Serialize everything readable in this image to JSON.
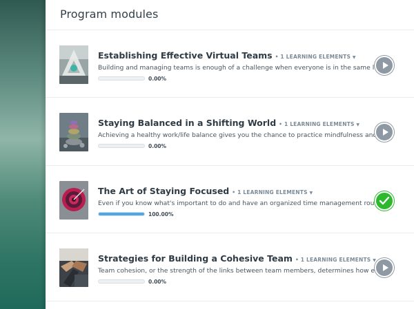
{
  "header": {
    "title": "Program modules"
  },
  "modules": [
    {
      "title": "Establishing Effective Virtual Teams",
      "elements_label": "• 1 LEARNING ELEMENTS",
      "description": "Building and managing teams is enough of a challenge when everyone is in the same location. Provi",
      "progress_label": "0.00%",
      "progress": 0,
      "status_icon": "play-icon"
    },
    {
      "title": "Staying Balanced in a Shifting World",
      "elements_label": "• 1 LEARNING ELEMENTS",
      "description": "Achieving a healthy work/life balance gives you the chance to practice mindfulness and focus on wh",
      "progress_label": "0.00%",
      "progress": 0,
      "status_icon": "play-icon"
    },
    {
      "title": "The Art of Staying Focused",
      "elements_label": "• 1 LEARNING ELEMENTS",
      "description": "Even if you know what's important to do and have an organized time management routine, losing fo",
      "progress_label": "100.00%",
      "progress": 1,
      "status_icon": "check-icon"
    },
    {
      "title": "Strategies for Building a Cohesive Team",
      "elements_label": "• 1 LEARNING ELEMENTS",
      "description": "Team cohesion, or the strength of the links between team members, determines how effective team",
      "progress_label": "0.00%",
      "progress": 0,
      "status_icon": "play-icon"
    }
  ],
  "colors": {
    "progress_fill": "#4aa8e6",
    "complete": "#2eb82e",
    "play": "#8e99a3"
  }
}
